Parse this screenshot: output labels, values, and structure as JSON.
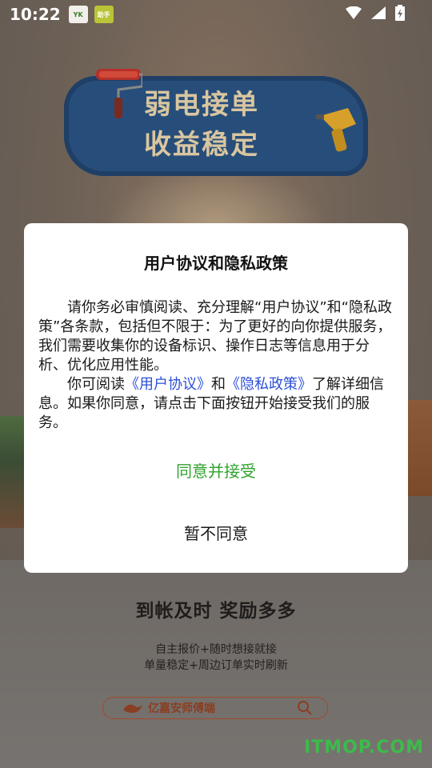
{
  "status_bar": {
    "time": "10:22",
    "badge1": "YK",
    "badge2": "助手"
  },
  "splash": {
    "banner_line1": "弱电接单",
    "banner_line2": "收益稳定",
    "promo_title": "到帐及时 奖励多多",
    "promo_sub1": "自主报价+随时想接就接",
    "promo_sub2": "单量稳定+周边订单实时刷新",
    "search_label": "亿嘉安师傅端"
  },
  "dialog": {
    "title": "用户协议和隐私政策",
    "para1": "请你务必审慎阅读、充分理解“用户协议”和“隐私政策”各条款，包括但不限于：为了更好的向你提供服务，我们需要收集你的设备标识、操作日志等信息用于分析、优化应用性能。",
    "para2_prefix": "你可阅读",
    "link_user_agreement": "《用户协议》",
    "para2_and": "和",
    "link_privacy_policy": "《隐私政策》",
    "para2_suffix": "了解详细信息。如果你同意，请点击下面按钮开始接受我们的服务。",
    "agree_label": "同意并接受",
    "disagree_label": "暂不同意"
  },
  "watermark": "ITMOP.COM",
  "colors": {
    "agree": "#2fa32f",
    "link": "#2b4fd6",
    "banner": "#274e7a",
    "watermark": "#3dbb4a"
  }
}
